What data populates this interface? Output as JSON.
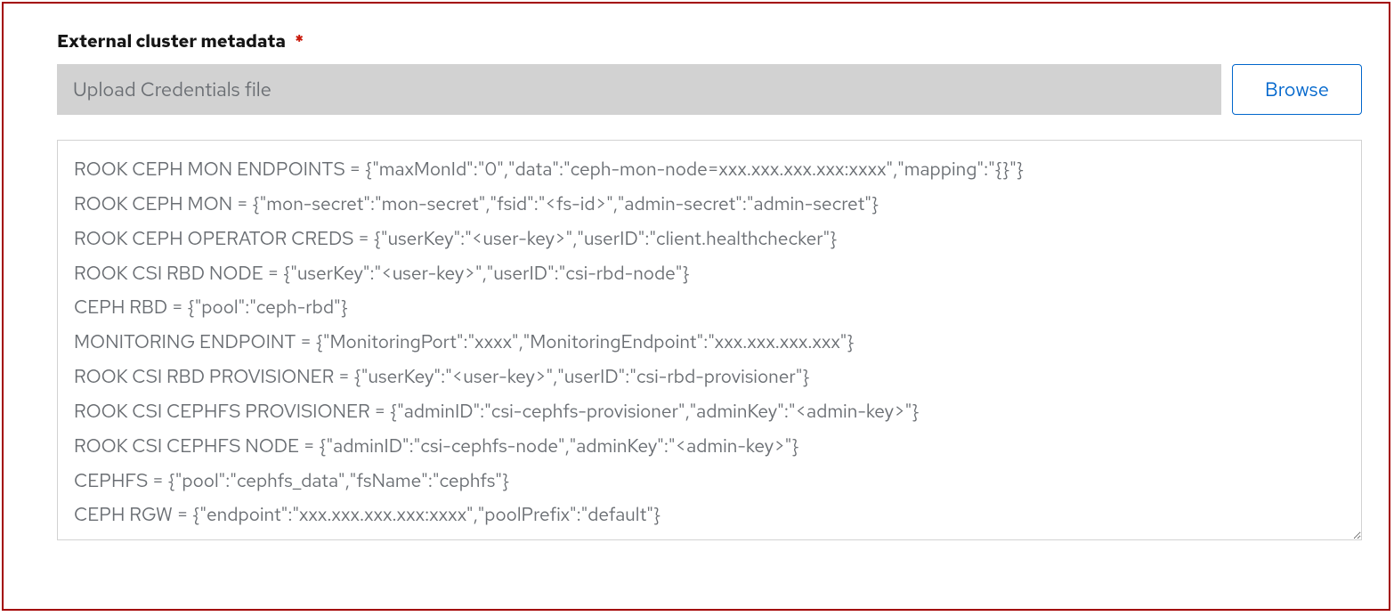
{
  "form": {
    "label": "External cluster metadata",
    "required_marker": "*",
    "upload_placeholder": "Upload Credentials file",
    "browse_label": "Browse",
    "metadata_lines": [
      "ROOK CEPH MON ENDPOINTS = {\"maxMonId\":\"0\",\"data\":\"ceph-mon-node=xxx.xxx.xxx.xxx:xxxx\",\"mapping\":\"{}\"}",
      "ROOK CEPH MON = {\"mon-secret\":\"mon-secret\",\"fsid\":\"<fs-id>\",\"admin-secret\":\"admin-secret\"}",
      "ROOK CEPH OPERATOR CREDS = {\"userKey\":\"<user-key>\",\"userID\":\"client.healthchecker\"}",
      "ROOK CSI RBD NODE = {\"userKey\":\"<user-key>\",\"userID\":\"csi-rbd-node\"}",
      "CEPH RBD = {\"pool\":\"ceph-rbd\"}",
      "MONITORING ENDPOINT = {\"MonitoringPort\":\"xxxx\",\"MonitoringEndpoint\":\"xxx.xxx.xxx.xxx\"}",
      "ROOK CSI RBD PROVISIONER = {\"userKey\":\"<user-key>\",\"userID\":\"csi-rbd-provisioner\"}",
      "ROOK CSI CEPHFS PROVISIONER = {\"adminID\":\"csi-cephfs-provisioner\",\"adminKey\":\"<admin-key>\"}",
      "ROOK CSI CEPHFS NODE = {\"adminID\":\"csi-cephfs-node\",\"adminKey\":\"<admin-key>\"}",
      "CEPHFS = {\"pool\":\"cephfs_data\",\"fsName\":\"cephfs\"}",
      "CEPH RGW = {\"endpoint\":\"xxx.xxx.xxx.xxx:xxxx\",\"poolPrefix\":\"default\"}"
    ]
  }
}
